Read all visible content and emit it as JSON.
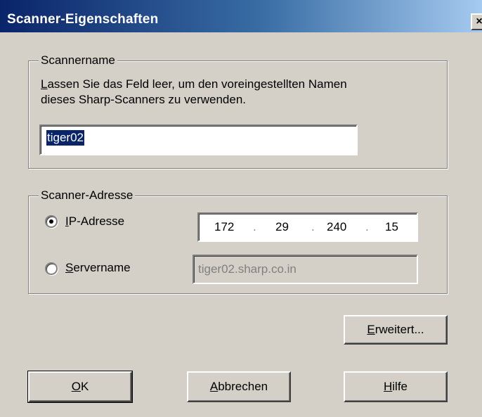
{
  "window": {
    "title": "Scanner-Eigenschaften",
    "close_glyph": "×"
  },
  "scanner_name_group": {
    "legend": "Scannername",
    "instruction_line1_mnemonic": "L",
    "instruction_line1_rest": "assen Sie das Feld leer, um den voreingestellten Namen",
    "instruction_line2": "dieses Sharp-Scanners zu verwenden.",
    "name_value": "tiger02"
  },
  "address_group": {
    "legend": "Scanner-Adresse",
    "ip_option": {
      "mnemonic": "I",
      "rest": "P-Adresse",
      "selected": true
    },
    "server_option": {
      "mnemonic": "S",
      "rest": "ervername",
      "selected": false
    },
    "ip_octets": [
      "172",
      "29",
      "240",
      "15"
    ],
    "ip_separator": ".",
    "server_value": "tiger02.sharp.co.in"
  },
  "buttons": {
    "advanced": {
      "mnemonic": "E",
      "rest": "rweitert..."
    },
    "ok": {
      "mnemonic": "O",
      "rest": "K"
    },
    "cancel": {
      "mnemonic": "A",
      "rest": "bbrechen"
    },
    "help": {
      "mnemonic": "H",
      "rest": "ilfe"
    }
  }
}
